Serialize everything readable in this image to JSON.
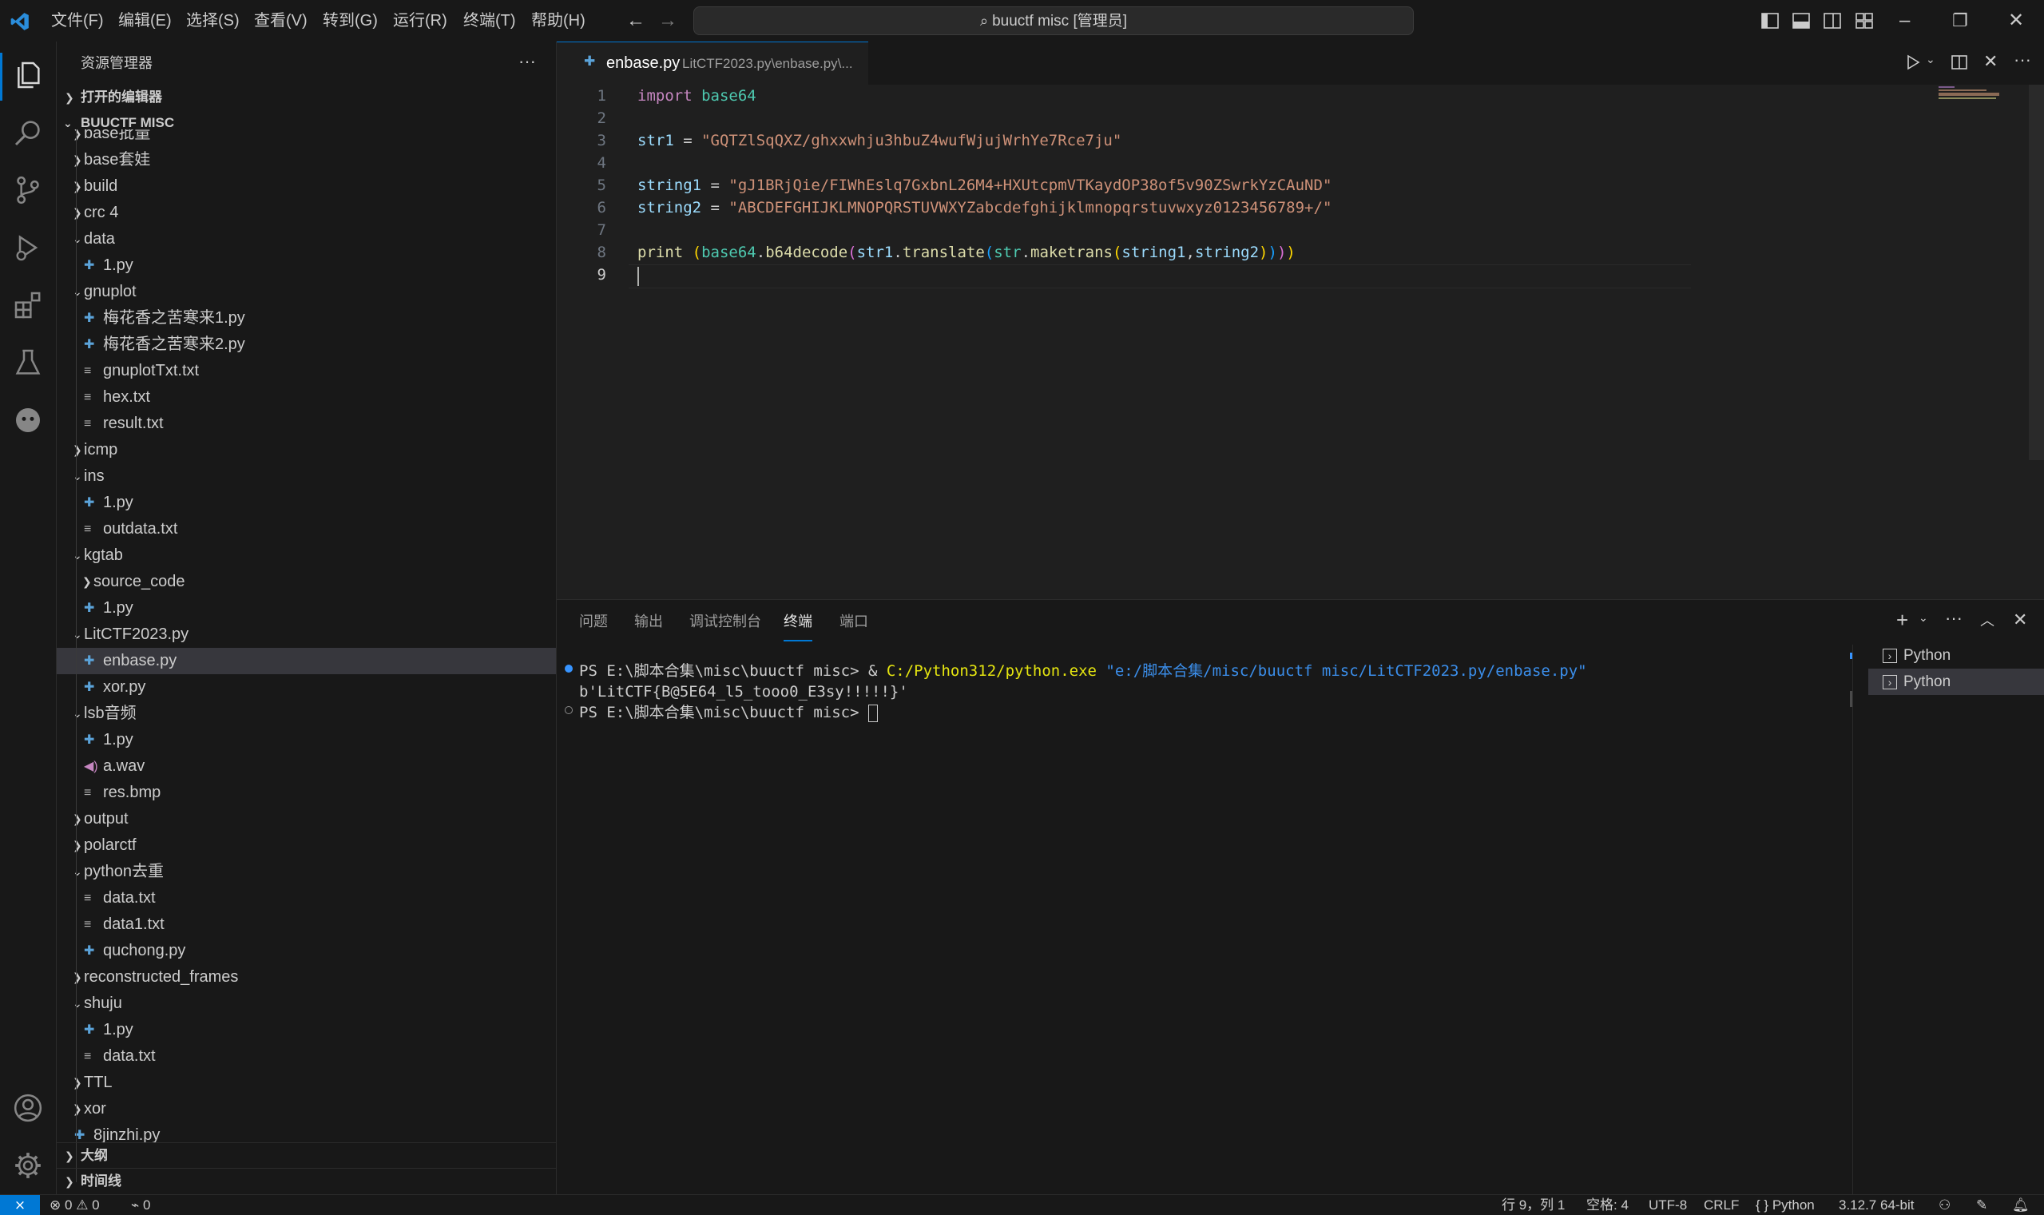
{
  "titlebar": {
    "menus": [
      "文件(F)",
      "编辑(E)",
      "选择(S)",
      "查看(V)",
      "转到(G)",
      "运行(R)",
      "终端(T)",
      "帮助(H)"
    ],
    "search": "buuctf misc [管理员]"
  },
  "sidebar": {
    "title": "资源管理器",
    "open_editors": "打开的编辑器",
    "workspace": "BUUCTF MISC",
    "outline": "大纲",
    "timeline": "时间线",
    "tree": [
      {
        "label": "base批量",
        "type": "folder",
        "depth": 1,
        "open": false
      },
      {
        "label": "base套娃",
        "type": "folder",
        "depth": 1,
        "open": false
      },
      {
        "label": "build",
        "type": "folder",
        "depth": 1,
        "open": false
      },
      {
        "label": "crc 4",
        "type": "folder",
        "depth": 1,
        "open": false
      },
      {
        "label": "data",
        "type": "folder",
        "depth": 1,
        "open": true
      },
      {
        "label": "1.py",
        "type": "py",
        "depth": 2
      },
      {
        "label": "gnuplot",
        "type": "folder",
        "depth": 1,
        "open": true
      },
      {
        "label": "梅花香之苦寒来1.py",
        "type": "py",
        "depth": 2
      },
      {
        "label": "梅花香之苦寒来2.py",
        "type": "py",
        "depth": 2
      },
      {
        "label": "gnuplotTxt.txt",
        "type": "txt",
        "depth": 2
      },
      {
        "label": "hex.txt",
        "type": "txt",
        "depth": 2
      },
      {
        "label": "result.txt",
        "type": "txt",
        "depth": 2
      },
      {
        "label": "icmp",
        "type": "folder",
        "depth": 1,
        "open": false
      },
      {
        "label": "ins",
        "type": "folder",
        "depth": 1,
        "open": true
      },
      {
        "label": "1.py",
        "type": "py",
        "depth": 2
      },
      {
        "label": "outdata.txt",
        "type": "txt",
        "depth": 2
      },
      {
        "label": "kgtab",
        "type": "folder",
        "depth": 1,
        "open": true
      },
      {
        "label": "source_code",
        "type": "folder",
        "depth": 2,
        "open": false
      },
      {
        "label": "1.py",
        "type": "py",
        "depth": 2
      },
      {
        "label": "LitCTF2023.py",
        "type": "folder",
        "depth": 1,
        "open": true
      },
      {
        "label": "enbase.py",
        "type": "py",
        "depth": 2,
        "selected": true
      },
      {
        "label": "xor.py",
        "type": "py",
        "depth": 2
      },
      {
        "label": "lsb音频",
        "type": "folder",
        "depth": 1,
        "open": true
      },
      {
        "label": "1.py",
        "type": "py",
        "depth": 2
      },
      {
        "label": "a.wav",
        "type": "wav",
        "depth": 2
      },
      {
        "label": "res.bmp",
        "type": "txt",
        "depth": 2
      },
      {
        "label": "output",
        "type": "folder",
        "depth": 1,
        "open": false
      },
      {
        "label": "polarctf",
        "type": "folder",
        "depth": 1,
        "open": false
      },
      {
        "label": "python去重",
        "type": "folder",
        "depth": 1,
        "open": true
      },
      {
        "label": "data.txt",
        "type": "txt",
        "depth": 2
      },
      {
        "label": "data1.txt",
        "type": "txt",
        "depth": 2
      },
      {
        "label": "quchong.py",
        "type": "py",
        "depth": 2
      },
      {
        "label": "reconstructed_frames",
        "type": "folder",
        "depth": 1,
        "open": false
      },
      {
        "label": "shuju",
        "type": "folder",
        "depth": 1,
        "open": true
      },
      {
        "label": "1.py",
        "type": "py",
        "depth": 2
      },
      {
        "label": "data.txt",
        "type": "txt",
        "depth": 2
      },
      {
        "label": "TTL",
        "type": "folder",
        "depth": 1,
        "open": false
      },
      {
        "label": "xor",
        "type": "folder",
        "depth": 1,
        "open": false
      },
      {
        "label": "8jinzhi.py",
        "type": "py",
        "depth": 1
      }
    ]
  },
  "editor": {
    "tab_title": "enbase.py",
    "tab_path": "LitCTF2023.py\\enbase.py\\...",
    "line_numbers": [
      "1",
      "2",
      "3",
      "4",
      "5",
      "6",
      "7",
      "8",
      "9"
    ],
    "code": {
      "l1_kw": "import",
      "l1_mod": "base64",
      "l3_var": "str1",
      "l3_eq": " = ",
      "l3_str": "\"GQTZlSqQXZ/ghxxwhju3hbuZ4wufWjujWrhYe7Rce7ju\"",
      "l5_var": "string1",
      "l5_eq": " = ",
      "l5_str": "\"gJ1BRjQie/FIWhEslq7GxbnL26M4+HXUtcpmVTKaydOP38of5v90ZSwrkYzCAuND\"",
      "l6_var": "string2",
      "l6_eq": " = ",
      "l6_str": "\"ABCDEFGHIJKLMNOPQRSTUVWXYZabcdefghijklmnopqrstuvwxyz0123456789+/\"",
      "l8_print": "print",
      "l8_mod": "base64",
      "l8_fn1": "b64decode",
      "l8_var1": "str1",
      "l8_fn2": "translate",
      "l8_mod2": "str",
      "l8_fn3": "maketrans",
      "l8_var2": "string1",
      "l8_var3": "string2"
    }
  },
  "panel": {
    "tabs": [
      "问题",
      "输出",
      "调试控制台",
      "终端",
      "端口"
    ],
    "active_tab": "终端",
    "terminal": {
      "prompt1": "PS E:\\脚本合集\\misc\\buuctf misc> & ",
      "exe": "C:/Python312/python.exe",
      "arg": "\"e:/脚本合集/misc/buuctf misc/LitCTF2023.py/enbase.py\"",
      "output": "b'LitCTF{B@5E64_l5_tooo0_E3sy!!!!!}'",
      "prompt2": "PS E:\\脚本合集\\misc\\buuctf misc> "
    },
    "terminal_list": [
      "Python",
      "Python"
    ]
  },
  "statusbar": {
    "errors": "0",
    "warnings": "0",
    "ports": "0",
    "position": "行 9，列 1",
    "spaces": "空格: 4",
    "encoding": "UTF-8",
    "eol": "CRLF",
    "language": "Python",
    "interpreter": "3.12.7 64-bit"
  }
}
